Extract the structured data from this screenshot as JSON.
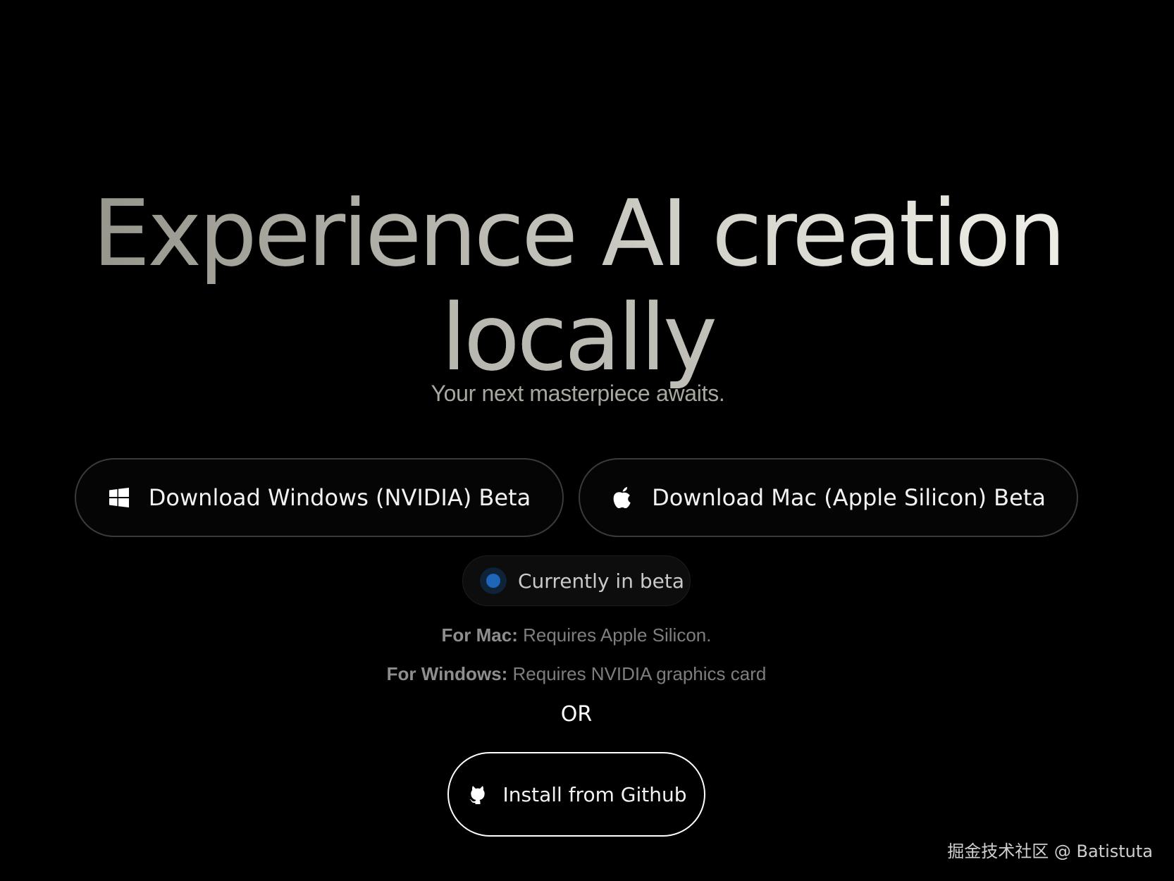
{
  "hero": {
    "line1": "Experience AI creation",
    "line2": "locally"
  },
  "subtitle": "Your next masterpiece awaits.",
  "buttons": {
    "windows": {
      "label": "Download Windows (NVIDIA) Beta",
      "icon": "windows-icon"
    },
    "mac": {
      "label": "Download Mac (Apple Silicon) Beta",
      "icon": "apple-icon"
    },
    "github": {
      "label": "Install from Github",
      "icon": "github-icon"
    }
  },
  "beta_badge": {
    "label": "Currently in beta",
    "dot_color": "#1f66b8"
  },
  "requirements": {
    "mac_label": "For Mac:",
    "mac_text": " Requires Apple Silicon.",
    "windows_label": "For Windows:",
    "windows_text": " Requires NVIDIA graphics card"
  },
  "or_text": "OR",
  "watermark": "掘金技术社区 @ Batistuta"
}
